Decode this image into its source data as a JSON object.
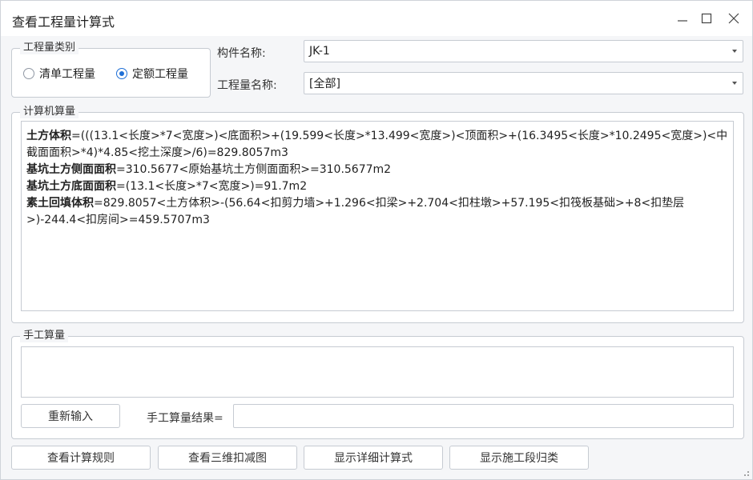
{
  "window": {
    "title": "查看工程量计算式"
  },
  "qty_category": {
    "legend": "工程量类别",
    "options": [
      {
        "label": "清单工程量",
        "selected": false
      },
      {
        "label": "定额工程量",
        "selected": true
      }
    ]
  },
  "component": {
    "label": "构件名称:",
    "value": "JK-1"
  },
  "qty_name": {
    "label": "工程量名称:",
    "value": "[全部]"
  },
  "computer_calc": {
    "legend": "计算机算量",
    "lines": [
      {
        "name": "土方体积",
        "expr": "=(((13.1<长度>*7<宽度>)<底面积>+(19.599<长度>*13.499<宽度>)<顶面积>+(16.3495<长度>*10.2495<宽度>)<中截面面积>*4)*4.85<挖土深度>/6)=829.8057m3"
      },
      {
        "name": "基坑土方侧面面积",
        "expr": "=310.5677<原始基坑土方侧面面积>=310.5677m2"
      },
      {
        "name": "基坑土方底面面积",
        "expr": "=(13.1<长度>*7<宽度>)=91.7m2"
      },
      {
        "name": "素土回填体积",
        "expr": "=829.8057<土方体积>-(56.64<扣剪力墙>+1.296<扣梁>+2.704<扣柱墩>+57.195<扣筏板基础>+8<扣垫层>)-244.4<扣房间>=459.5707m3"
      }
    ]
  },
  "manual_calc": {
    "legend": "手工算量",
    "reenter_label": "重新输入",
    "result_label": "手工算量结果=",
    "result_value": ""
  },
  "footer": {
    "buttons": [
      "查看计算规则",
      "查看三维扣减图",
      "显示详细计算式",
      "显示施工段归类"
    ]
  }
}
